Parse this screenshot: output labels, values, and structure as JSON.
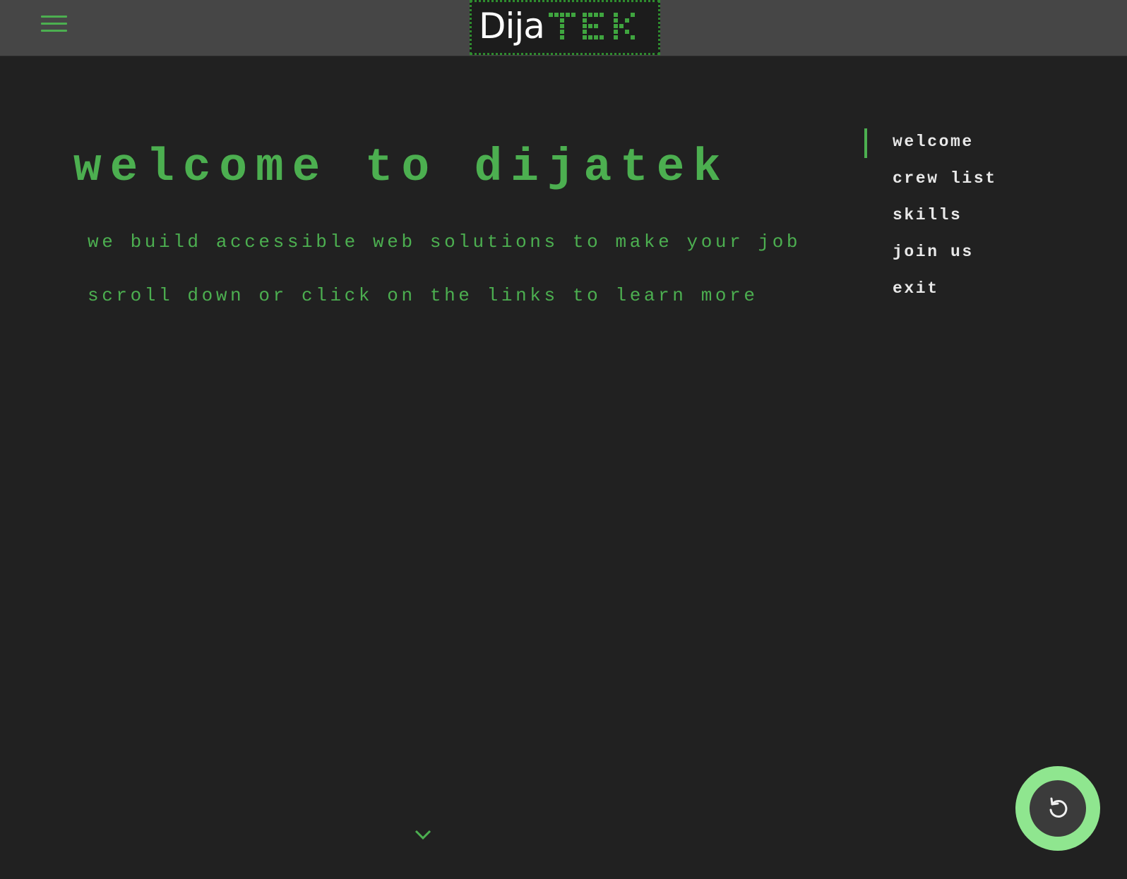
{
  "header": {
    "menu_icon": "hamburger-menu-icon",
    "logo": {
      "part1": "Dija",
      "part2": "TEK"
    }
  },
  "hero": {
    "title": "welcome to dijatek",
    "subtitle": "we build accessible web solutions to make your job",
    "hint": "scroll down or click on the links to learn more"
  },
  "side_nav": {
    "items": [
      {
        "label": "welcome",
        "active": true
      },
      {
        "label": "crew list",
        "active": false
      },
      {
        "label": "skills",
        "active": false
      },
      {
        "label": "join us",
        "active": false
      },
      {
        "label": "exit",
        "active": false
      }
    ]
  },
  "scroll_down_icon": "chevron-down-icon",
  "reset_button_icon": "undo-icon",
  "colors": {
    "accent": "#4caf50",
    "background": "#212121",
    "header": "#464646",
    "reset_ring": "#8fe68f",
    "nav_text": "#e8e8e8"
  }
}
